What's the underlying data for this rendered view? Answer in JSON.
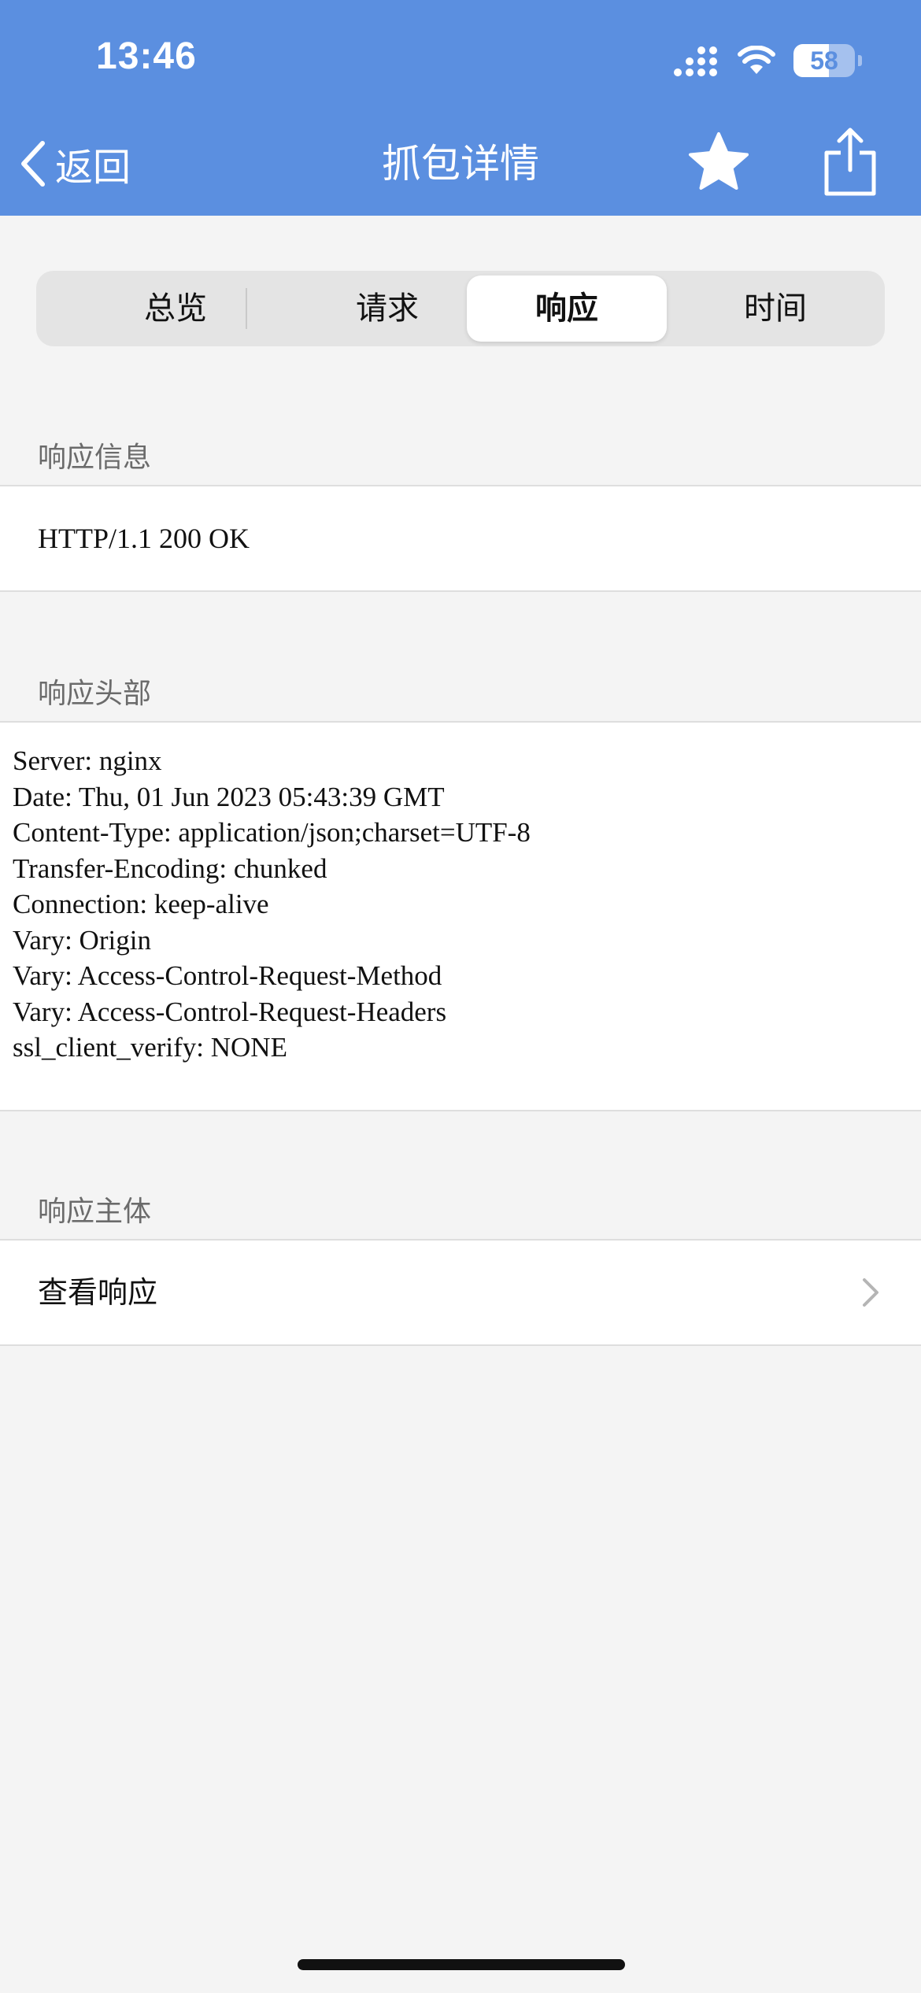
{
  "status_bar": {
    "time": "13:46",
    "battery_level": "58",
    "icons": [
      "signal-icon",
      "wifi-icon",
      "battery-icon"
    ]
  },
  "nav": {
    "back_label": "返回",
    "title": "抓包详情",
    "icons": [
      "chevron-left-icon",
      "star-icon",
      "share-icon"
    ]
  },
  "tabs": [
    {
      "label": "总览",
      "active": false
    },
    {
      "label": "请求",
      "active": false
    },
    {
      "label": "响应",
      "active": true
    },
    {
      "label": "时间",
      "active": false
    }
  ],
  "response_info": {
    "header": "响应信息",
    "status_line": "HTTP/1.1 200 OK"
  },
  "response_headers": {
    "header": "响应头部",
    "lines": [
      "Server: nginx",
      "Date: Thu, 01 Jun 2023 05:43:39 GMT",
      "Content-Type: application/json;charset=UTF-8",
      "Transfer-Encoding: chunked",
      "Connection: keep-alive",
      "Vary: Origin",
      "Vary: Access-Control-Request-Method",
      "Vary: Access-Control-Request-Headers",
      "ssl_client_verify: NONE"
    ]
  },
  "response_body": {
    "header": "响应主体",
    "view_label": "查看响应"
  },
  "colors": {
    "accent": "#5b8fe0",
    "background": "#f4f4f4",
    "cell": "#ffffff",
    "secondary_text": "#6b6b6b"
  }
}
